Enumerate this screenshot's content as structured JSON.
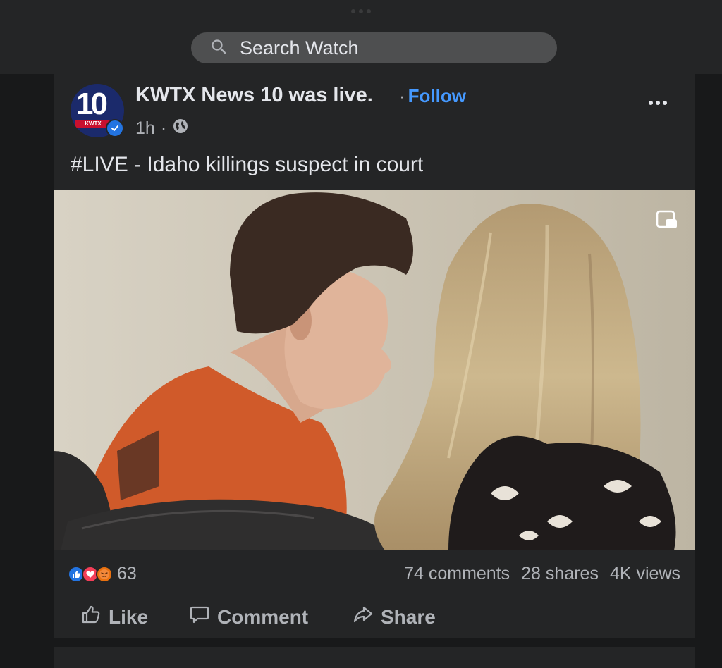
{
  "search": {
    "placeholder": "Search Watch"
  },
  "post": {
    "page_name": "KWTX News 10 was live.",
    "follow_separator": "·",
    "follow_label": "Follow",
    "time": "1h",
    "meta_separator": "·",
    "text": "#LIVE - Idaho killings suspect in court",
    "avatar": {
      "number": "10",
      "band": "KWTX"
    },
    "reaction_count": "63",
    "comments": "74 comments",
    "shares": "28 shares",
    "views": "4K views"
  },
  "actions": {
    "like": "Like",
    "comment": "Comment",
    "share": "Share"
  },
  "icons": {
    "search": "search-icon",
    "globe": "globe-icon",
    "verified": "verified-badge-icon",
    "more": "more-options-icon",
    "pip": "picture-in-picture-icon",
    "like": "thumbs-up-icon",
    "comment": "comment-bubble-icon",
    "share": "share-arrow-icon"
  },
  "colors": {
    "background": "#18191a",
    "card": "#242526",
    "accent": "#4599ff",
    "like_reaction": "#2374e1",
    "love_reaction": "#f33e58",
    "angry_reaction": "#e9710f"
  }
}
